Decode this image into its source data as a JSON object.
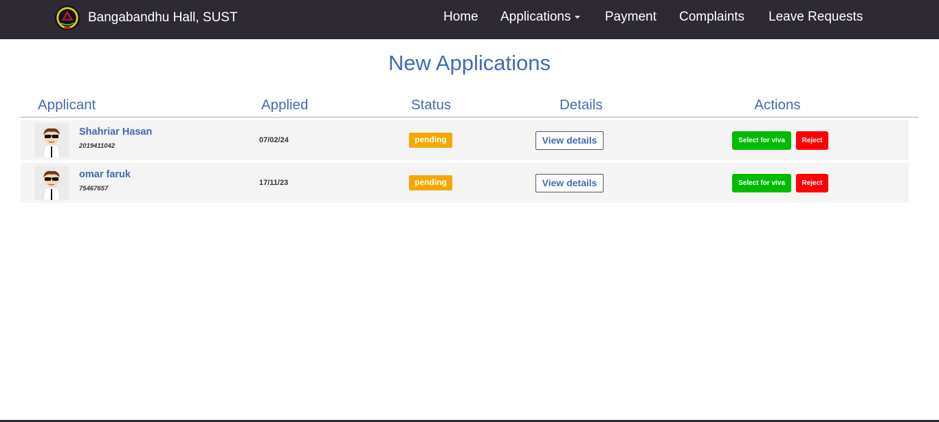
{
  "navbar": {
    "brand": "Bangabandhu Hall, SUST",
    "items": [
      {
        "label": "Home"
      },
      {
        "label": "Applications",
        "has_dropdown": true
      },
      {
        "label": "Payment"
      },
      {
        "label": "Complaints"
      },
      {
        "label": "Leave Requests"
      }
    ]
  },
  "page": {
    "title": "New Applications"
  },
  "table": {
    "columns": [
      "Applicant",
      "Applied",
      "Status",
      "Details",
      "Actions"
    ],
    "rows": [
      {
        "name": "Shahriar Hasan",
        "id": "2019411042",
        "applied": "07/02/24",
        "status": "pending",
        "details_label": "View details",
        "viva_label": "Select for viva",
        "reject_label": "Reject"
      },
      {
        "name": "omar faruk",
        "id": "75467657",
        "applied": "17/11/23",
        "status": "pending",
        "details_label": "View details",
        "viva_label": "Select for viva",
        "reject_label": "Reject"
      }
    ]
  },
  "colors": {
    "navbar_bg": "#2e2a33",
    "accent": "#4468b8",
    "pending": "#f5a800",
    "select_viva": "#00bb00",
    "reject": "#ff0000",
    "row_bg": "#f4f4f4"
  },
  "icons": {
    "brand": "hall-logo-icon",
    "avatar": "person-avatar-icon"
  }
}
